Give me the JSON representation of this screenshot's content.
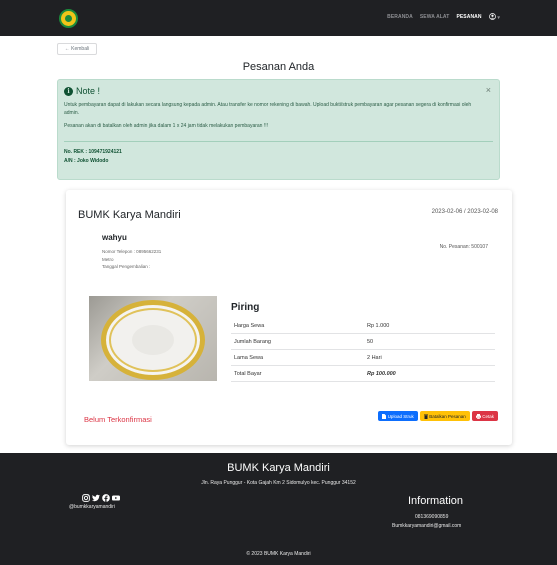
{
  "navbar": {
    "links": [
      "BERANDA",
      "SEWA ALAT",
      "PESANAN"
    ],
    "active": "PESANAN",
    "user_icon": "user-circle-icon",
    "caret": "▾"
  },
  "back_label": "← Kembali",
  "page_title": "Pesanan Anda",
  "alert": {
    "title": "Note !",
    "message": "Untuk pembayaran dapat di lakukan secara langsung kepada admin. Atau transfer ke nomor rekening di bawah. Upload bukti/struk pembayaran agar pesanan segera di konfirmasi oleh admin.",
    "warning": "Pesanan akan di batalkan oleh admin jika dalam 1 x 24 jam tidak melakukan pembayaran !!!",
    "rek": "No. REK : 109471924121",
    "an": "A/N : Joko Widodo",
    "close": "×"
  },
  "order": {
    "shop_name": "BUMK Karya Mandiri",
    "date_range": "2023-02-06 / 2023-02-08",
    "customer_name": "wahyu",
    "order_no": "No. Pesanan: 500107",
    "phone_line": "Nomor Telepon : 0895662231",
    "city": "Metro",
    "pickup": "Tanggal Pengembalian :",
    "product": "Piring",
    "rows": [
      {
        "k": "Harga Sewa",
        "v": "Rp 1.000"
      },
      {
        "k": "Jumlah Barang",
        "v": "50"
      },
      {
        "k": "Lama Sewa",
        "v": "2 Hari"
      },
      {
        "k": "Total Bayar",
        "v": "Rp 100.000"
      }
    ],
    "status": "Belum Terkonfirmasi",
    "btn_upload": "Upload Struk",
    "btn_cancel": "Batalkan Pesanan",
    "btn_print": "Cetak"
  },
  "footer": {
    "title": "BUMK Karya Mandiri",
    "address": "Jln. Raya Punggur - Kota Gajah Km 2 Sidomulyo kec. Punggur 34152",
    "handle": "@bumkkaryamandiri",
    "info_title": "Information",
    "phone": "081369090859",
    "email": "Bumkkaryamandiri@gmail.com",
    "copyright": "© 2023 BUMK Karya Mandiri"
  },
  "colors": {
    "navbar": "#1f2023",
    "alert_bg": "#d1e7dd",
    "status": "#dc3545",
    "btn_upload": "#0d6efd",
    "btn_cancel": "#ffc107",
    "btn_print": "#dc3545"
  }
}
